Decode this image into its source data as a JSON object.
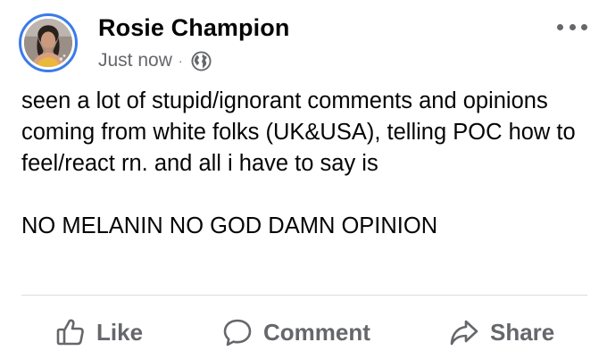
{
  "post": {
    "author": "Rosie Champion",
    "timestamp": "Just now",
    "separator": "·",
    "privacy_icon": "globe-icon",
    "more_icon": "more-options-icon",
    "body": [
      "seen a lot of stupid/ignorant comments and opinions coming from white folks (UK&USA), telling POC how to feel/react rn. and all i have to say is",
      "NO MELANIN NO GOD DAMN OPINION"
    ]
  },
  "actions": {
    "like_label": "Like",
    "comment_label": "Comment",
    "share_label": "Share"
  },
  "colors": {
    "avatar_ring": "#3b7be8",
    "text_primary": "#050505",
    "text_secondary": "#65676b",
    "divider": "#dadde1"
  }
}
